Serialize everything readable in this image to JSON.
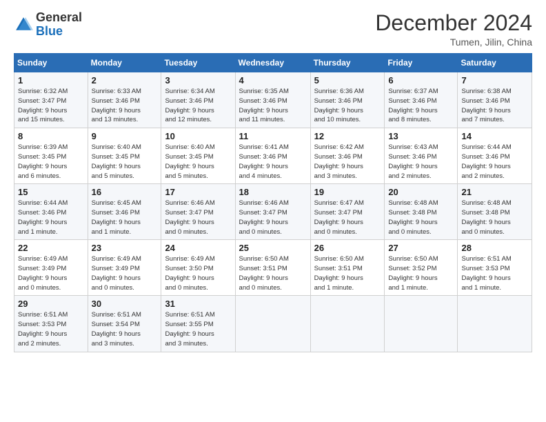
{
  "header": {
    "logo_general": "General",
    "logo_blue": "Blue",
    "month_title": "December 2024",
    "subtitle": "Tumen, Jilin, China"
  },
  "weekdays": [
    "Sunday",
    "Monday",
    "Tuesday",
    "Wednesday",
    "Thursday",
    "Friday",
    "Saturday"
  ],
  "weeks": [
    [
      {
        "day": "1",
        "sunrise": "6:32 AM",
        "sunset": "3:47 PM",
        "daylight": "9 hours and 15 minutes."
      },
      {
        "day": "2",
        "sunrise": "6:33 AM",
        "sunset": "3:46 PM",
        "daylight": "9 hours and 13 minutes."
      },
      {
        "day": "3",
        "sunrise": "6:34 AM",
        "sunset": "3:46 PM",
        "daylight": "9 hours and 12 minutes."
      },
      {
        "day": "4",
        "sunrise": "6:35 AM",
        "sunset": "3:46 PM",
        "daylight": "9 hours and 11 minutes."
      },
      {
        "day": "5",
        "sunrise": "6:36 AM",
        "sunset": "3:46 PM",
        "daylight": "9 hours and 10 minutes."
      },
      {
        "day": "6",
        "sunrise": "6:37 AM",
        "sunset": "3:46 PM",
        "daylight": "9 hours and 8 minutes."
      },
      {
        "day": "7",
        "sunrise": "6:38 AM",
        "sunset": "3:46 PM",
        "daylight": "9 hours and 7 minutes."
      }
    ],
    [
      {
        "day": "8",
        "sunrise": "6:39 AM",
        "sunset": "3:45 PM",
        "daylight": "9 hours and 6 minutes."
      },
      {
        "day": "9",
        "sunrise": "6:40 AM",
        "sunset": "3:45 PM",
        "daylight": "9 hours and 5 minutes."
      },
      {
        "day": "10",
        "sunrise": "6:40 AM",
        "sunset": "3:45 PM",
        "daylight": "9 hours and 5 minutes."
      },
      {
        "day": "11",
        "sunrise": "6:41 AM",
        "sunset": "3:46 PM",
        "daylight": "9 hours and 4 minutes."
      },
      {
        "day": "12",
        "sunrise": "6:42 AM",
        "sunset": "3:46 PM",
        "daylight": "9 hours and 3 minutes."
      },
      {
        "day": "13",
        "sunrise": "6:43 AM",
        "sunset": "3:46 PM",
        "daylight": "9 hours and 2 minutes."
      },
      {
        "day": "14",
        "sunrise": "6:44 AM",
        "sunset": "3:46 PM",
        "daylight": "9 hours and 2 minutes."
      }
    ],
    [
      {
        "day": "15",
        "sunrise": "6:44 AM",
        "sunset": "3:46 PM",
        "daylight": "9 hours and 1 minute."
      },
      {
        "day": "16",
        "sunrise": "6:45 AM",
        "sunset": "3:46 PM",
        "daylight": "9 hours and 1 minute."
      },
      {
        "day": "17",
        "sunrise": "6:46 AM",
        "sunset": "3:47 PM",
        "daylight": "9 hours and 0 minutes."
      },
      {
        "day": "18",
        "sunrise": "6:46 AM",
        "sunset": "3:47 PM",
        "daylight": "9 hours and 0 minutes."
      },
      {
        "day": "19",
        "sunrise": "6:47 AM",
        "sunset": "3:47 PM",
        "daylight": "9 hours and 0 minutes."
      },
      {
        "day": "20",
        "sunrise": "6:48 AM",
        "sunset": "3:48 PM",
        "daylight": "9 hours and 0 minutes."
      },
      {
        "day": "21",
        "sunrise": "6:48 AM",
        "sunset": "3:48 PM",
        "daylight": "9 hours and 0 minutes."
      }
    ],
    [
      {
        "day": "22",
        "sunrise": "6:49 AM",
        "sunset": "3:49 PM",
        "daylight": "9 hours and 0 minutes."
      },
      {
        "day": "23",
        "sunrise": "6:49 AM",
        "sunset": "3:49 PM",
        "daylight": "9 hours and 0 minutes."
      },
      {
        "day": "24",
        "sunrise": "6:49 AM",
        "sunset": "3:50 PM",
        "daylight": "9 hours and 0 minutes."
      },
      {
        "day": "25",
        "sunrise": "6:50 AM",
        "sunset": "3:51 PM",
        "daylight": "9 hours and 0 minutes."
      },
      {
        "day": "26",
        "sunrise": "6:50 AM",
        "sunset": "3:51 PM",
        "daylight": "9 hours and 1 minute."
      },
      {
        "day": "27",
        "sunrise": "6:50 AM",
        "sunset": "3:52 PM",
        "daylight": "9 hours and 1 minute."
      },
      {
        "day": "28",
        "sunrise": "6:51 AM",
        "sunset": "3:53 PM",
        "daylight": "9 hours and 1 minute."
      }
    ],
    [
      {
        "day": "29",
        "sunrise": "6:51 AM",
        "sunset": "3:53 PM",
        "daylight": "9 hours and 2 minutes."
      },
      {
        "day": "30",
        "sunrise": "6:51 AM",
        "sunset": "3:54 PM",
        "daylight": "9 hours and 3 minutes."
      },
      {
        "day": "31",
        "sunrise": "6:51 AM",
        "sunset": "3:55 PM",
        "daylight": "9 hours and 3 minutes."
      },
      null,
      null,
      null,
      null
    ]
  ]
}
